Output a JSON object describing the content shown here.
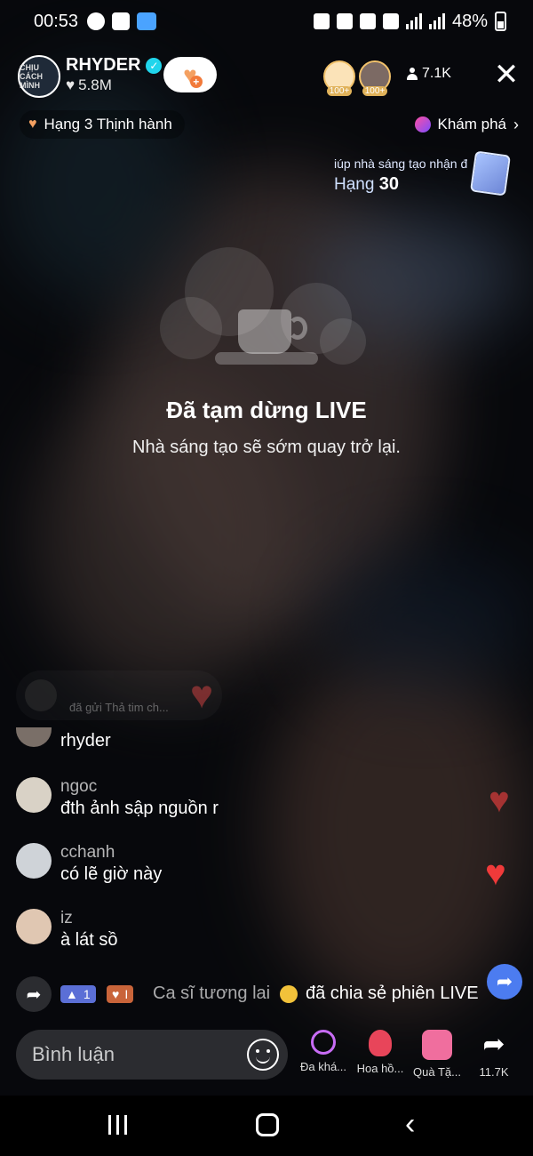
{
  "status_bar": {
    "time": "00:53",
    "battery": "48%"
  },
  "creator": {
    "name": "RHYDER",
    "likes": "5.8M",
    "avatar_text": "CHỊU CÁCH MÌNH"
  },
  "viewers": {
    "badges": [
      "100+",
      "100+"
    ],
    "count": "7.1K"
  },
  "rank_pill": {
    "text": "Hạng 3 Thịnh hành"
  },
  "explore": {
    "label": "Khám phá"
  },
  "promo": {
    "text": "iúp nhà sáng tạo nhận đ",
    "rank_label": "Hạng",
    "rank_value": "30"
  },
  "paused": {
    "title": "Đã tạm dừng LIVE",
    "subtitle": "Nhà sáng tạo sẽ sớm quay trở lại."
  },
  "gift_notice": {
    "text": "đã gửi Thả tim ch..."
  },
  "comments": [
    {
      "user": "",
      "text": "rhyder"
    },
    {
      "user": "ngoc",
      "text": "đth ảnh sập nguồn r"
    },
    {
      "user": "cchanh",
      "text": "có lẽ giờ này"
    },
    {
      "user": "iz",
      "text": "à lát sồ"
    }
  ],
  "share_notice": {
    "badge_level": "1",
    "badge_fan": "I",
    "name": "Ca sĩ tương lai",
    "action": "đã chia sẻ phiên LIVE"
  },
  "bottom_bar": {
    "comment_placeholder": "Bình luận",
    "items": [
      {
        "icon": "multi-guest-icon",
        "label": "Đa khá..."
      },
      {
        "icon": "rose-icon",
        "label": "Hoa hồ..."
      },
      {
        "icon": "gift-icon",
        "label": "Quà Tặ..."
      },
      {
        "icon": "share-icon",
        "label": "11.7K"
      }
    ]
  },
  "colors": {
    "accent_orange": "#f4a061",
    "verified": "#20d5ec",
    "heart_red": "#f03a3a",
    "share_blue": "#4c7cf0"
  }
}
